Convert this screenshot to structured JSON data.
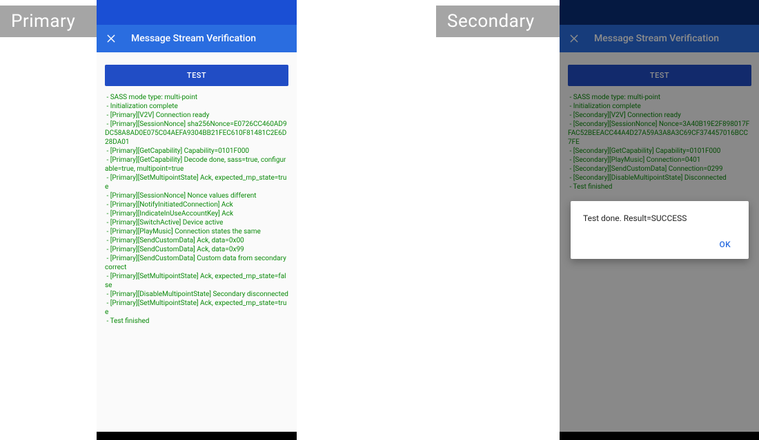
{
  "labels": {
    "primary": "Primary",
    "secondary": "Secondary"
  },
  "primary": {
    "header": {
      "title": "Message Stream Verification"
    },
    "test_button_label": "TEST",
    "log_lines": [
      " - SASS mode type: multi-point",
      " - Initialization complete",
      " - [Primary][V2V] Connection ready",
      " - [Primary][SessionNonce] sha256Nonce=E0726CC460AD9DC58A8AD0E075C04AEFA9304BB21FEC610F81481C2E6D28DA01",
      " - [Primary][GetCapability] Capability=0101F000",
      " - [Primary][GetCapability] Decode done, sass=true, configurable=true, multipoint=true",
      " - [Primary][SetMultipointState] Ack, expected_mp_state=true",
      " - [Primary][SessionNonce] Nonce values different",
      " - [Primary][NotifyInitiatedConnection] Ack",
      " - [Primary][IndicateInUseAccountKey] Ack",
      " - [Primary][SwitchActive] Device active",
      " - [Primary][PlayMusic] Connection states the same",
      " - [Primary][SendCustomData] Ack, data=0x00",
      " - [Primary][SendCustomData] Ack, data=0x99",
      " - [Primary][SendCustomData] Custom data from secondary correct",
      " - [Primary][SetMultipointState] Ack, expected_mp_state=false",
      " - [Primary][DisableMultipointState] Secondary disconnected",
      " - [Primary][SetMultipointState] Ack, expected_mp_state=true",
      " - Test finished"
    ]
  },
  "secondary": {
    "header": {
      "title": "Message Stream Verification"
    },
    "test_button_label": "TEST",
    "log_lines": [
      " - SASS mode type: multi-point",
      " - Initialization complete",
      " - [Secondary][V2V] Connection ready",
      " - [Secondary][SessionNonce] Nonce=3A40B19E2F898017FFAC52BEEACC44A4D27A59A3A8A3C69CF374457016BCC7FE",
      " - [Secondary][GetCapability] Capability=0101F000",
      " - [Secondary][PlayMusic] Connection=0401",
      " - [Secondary][SendCustomData] Connection=0299",
      " - [Secondary][DisableMultipointState] Disconnected",
      " - Test finished"
    ],
    "dialog": {
      "message": "Test done. Result=SUCCESS",
      "ok_label": "OK"
    }
  }
}
